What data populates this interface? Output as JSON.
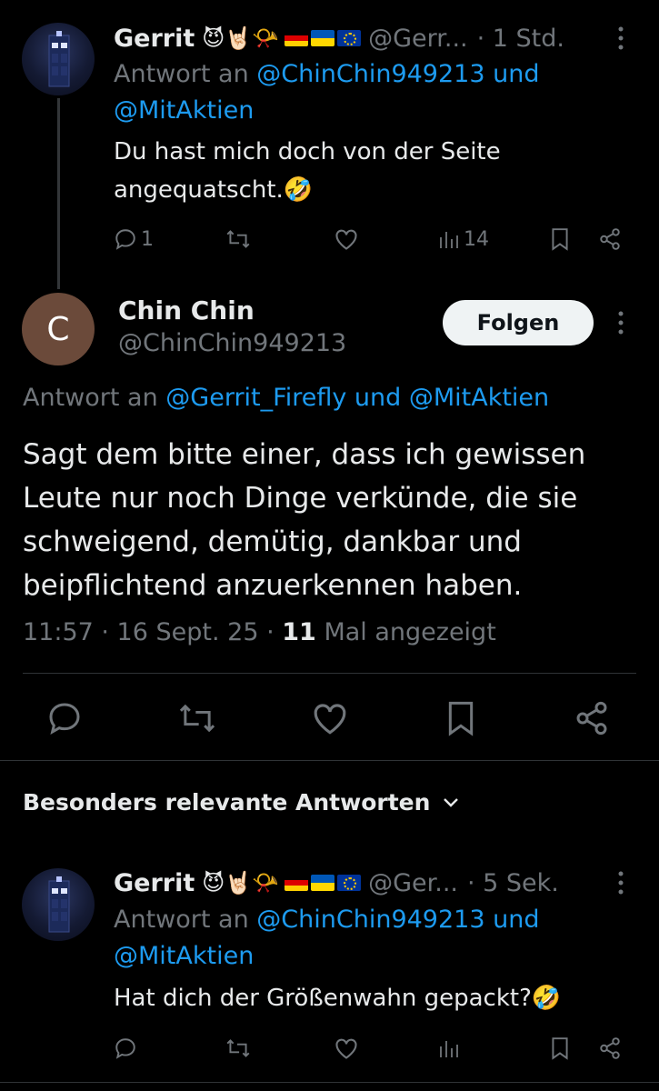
{
  "reply_top": {
    "name": "Gerrit",
    "emojis": "😈🤘🏻📯",
    "handle": "@Gerr...",
    "time": "· 1 Std.",
    "reply_prefix": "Antwort an",
    "mention1": "@ChinChin949213 und",
    "mention2": "@MitAktien",
    "text": "Du hast mich doch von der Seite angequatscht.🤣",
    "reply_count": "1",
    "view_count": "14"
  },
  "main_post": {
    "avatar_letter": "C",
    "name": "Chin Chin",
    "handle": "@ChinChin949213",
    "follow_label": "Folgen",
    "reply_prefix": "Antwort an",
    "mentions": "@Gerrit_Firefly und @MitAktien",
    "text": "Sagt dem bitte einer, dass ich gewissen Leute nur noch Dinge verkünde, die sie schweigend, demütig, dankbar und beipflichtend anzuerkennen haben.",
    "timestamp": "11:57 · 16 Sept. 25 ·",
    "view_count": "11",
    "view_label": "Mal angezeigt"
  },
  "sort_label": "Besonders relevante Antworten",
  "reply_bottom": {
    "name": "Gerrit",
    "emojis": "😈🤘🏻📯",
    "handle": "@Ger...",
    "time": "· 5 Sek.",
    "reply_prefix": "Antwort an",
    "mention1": "@ChinChin949213 und",
    "mention2": "@MitAktien",
    "text": "Hat dich der Größenwahn gepackt?🤣"
  },
  "colors": {
    "background": "#000000",
    "link": "#1d9bf0",
    "muted": "#71767b",
    "text": "#e7e9ea"
  }
}
